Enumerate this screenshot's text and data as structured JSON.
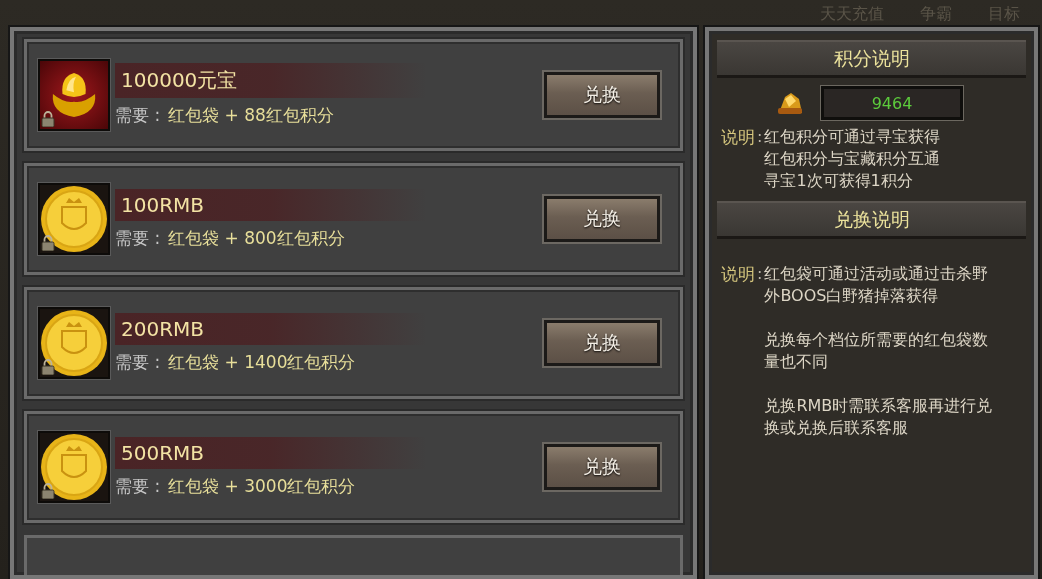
{
  "background_menu": [
    {
      "label": "天天充值"
    },
    {
      "label": "争霸"
    },
    {
      "label": "目标"
    }
  ],
  "rewards": [
    {
      "title": "100000元宝",
      "kind": "ingot",
      "locked": true,
      "requirement_label": "需要 :",
      "requirement": "红包袋 + 88红包积分",
      "button": "兑换"
    },
    {
      "title": "100RMB",
      "kind": "coin",
      "locked": true,
      "requirement_label": "需要 :",
      "requirement": "红包袋 + 800红包积分",
      "button": "兑换"
    },
    {
      "title": "200RMB",
      "kind": "coin",
      "locked": true,
      "requirement_label": "需要 :",
      "requirement": "红包袋 + 1400红包积分",
      "button": "兑换"
    },
    {
      "title": "500RMB",
      "kind": "coin",
      "locked": true,
      "requirement_label": "需要 :",
      "requirement": "红包袋 + 3000红包积分",
      "button": "兑换"
    }
  ],
  "points_info": {
    "title": "积分说明",
    "score": "9464",
    "label": "说明",
    "colon": ":",
    "lines": [
      "红包积分可通过寻宝获得",
      "红包积分与宝藏积分互通",
      "寻宝1次可获得1积分"
    ]
  },
  "exchange_info": {
    "title": "兑换说明",
    "label": "说明",
    "colon": ":",
    "paragraphs": [
      "红包袋可通过活动或通过击杀野外BOOS白野猪掉落获得",
      "兑换每个档位所需要的红包袋数量也不同",
      "兑换RMB时需联系客服再进行兑换或兑换后联系客服"
    ]
  }
}
